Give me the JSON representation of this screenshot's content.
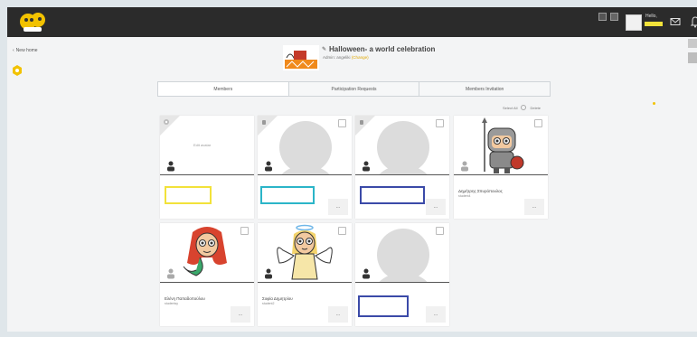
{
  "header": {
    "hello_text": "Hello,",
    "colors": {
      "bar": "#2b2b2b",
      "accent": "#f2e23a"
    },
    "icons": [
      "logo-icon",
      "mail-icon",
      "bell-icon"
    ]
  },
  "nav": {
    "back_label": "New home"
  },
  "group": {
    "title": "Halloween- a world celebration",
    "admin_prefix": "Admin:",
    "admin_name": "angeliki",
    "change_label": "(Change)"
  },
  "tabs": [
    {
      "label": "Members",
      "active": true
    },
    {
      "label": "Participation Requests",
      "active": false
    },
    {
      "label": "Members Invitation",
      "active": false
    }
  ],
  "select_all": {
    "label": "Select All",
    "action": "Delete"
  },
  "members": [
    {
      "type": "empty",
      "edit_label": "Edit avatar",
      "name": "",
      "username": "",
      "box_color": "#f2e23a"
    },
    {
      "type": "placeholder",
      "name": "",
      "username": "",
      "box_color": "#2bb5c8",
      "more": "..."
    },
    {
      "type": "placeholder",
      "name": "",
      "username": "",
      "box_color": "#3b4aa8",
      "more": "..."
    },
    {
      "type": "knight",
      "name": "Δημήτρης Σπυρόπουλος",
      "username": "student4",
      "more": "..."
    },
    {
      "type": "mermaid",
      "name": "Ελένη Παπαδοπούλου",
      "username": "studentsy",
      "more": "..."
    },
    {
      "type": "angel",
      "name": "Σοφία Δημητρίου",
      "username": "student2",
      "more": "..."
    },
    {
      "type": "placeholder",
      "name": "",
      "username": "",
      "box_color": "#3b4aa8",
      "more": "..."
    }
  ]
}
